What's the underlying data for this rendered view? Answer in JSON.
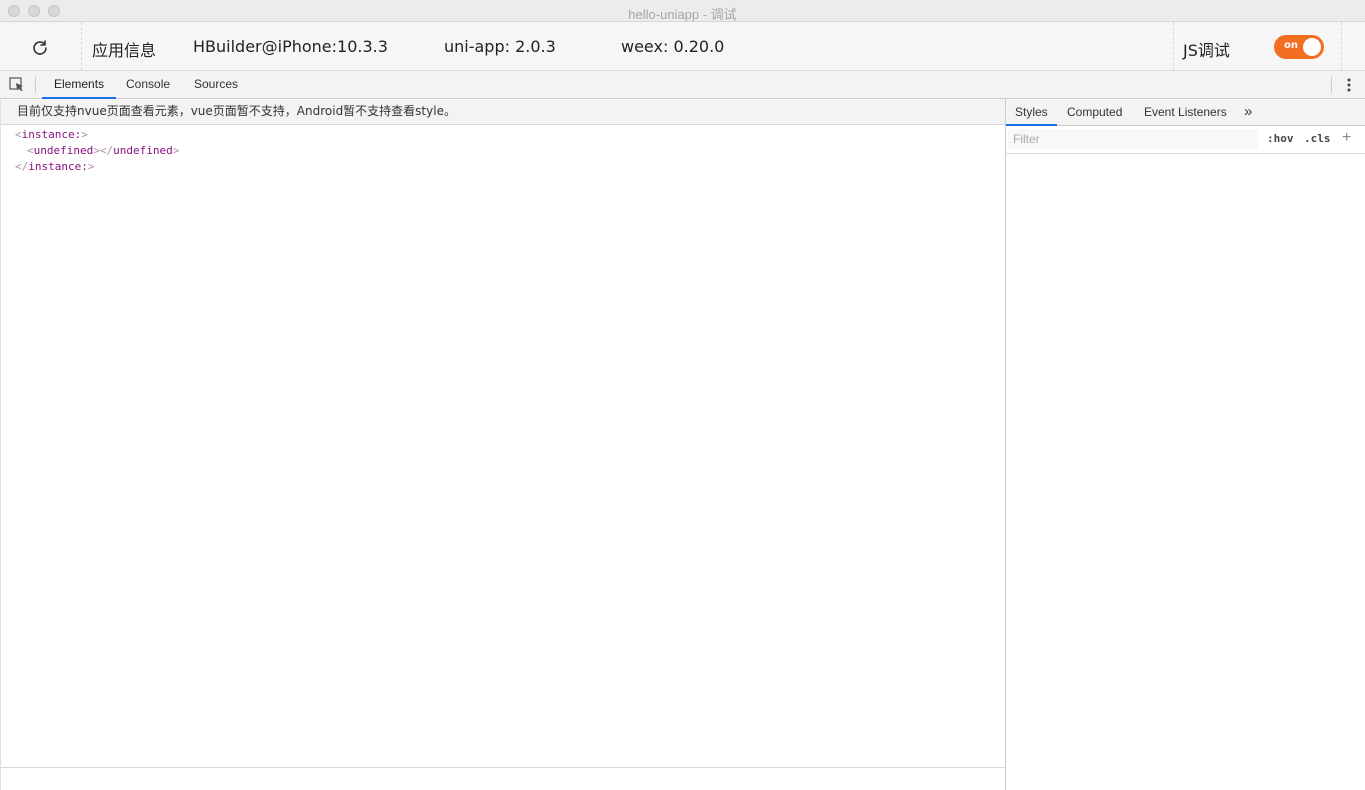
{
  "window": {
    "title": "hello-uniapp - 调试"
  },
  "infobar": {
    "app_info": "应用信息",
    "device": "HBuilder@iPhone:10.3.3",
    "uniapp_version": "uni-app: 2.0.3",
    "weex_version": "weex: 0.20.0",
    "js_debug_label": "JS调试",
    "toggle_label": "on"
  },
  "devtools": {
    "tabs": [
      {
        "label": "Elements"
      },
      {
        "label": "Console"
      },
      {
        "label": "Sources"
      }
    ]
  },
  "elements": {
    "notice": "目前仅支持nvue页面查看元素，vue页面暂不支持，Android暂不支持查看style。",
    "tree": {
      "root_tag": "instance:",
      "child_tag": "undefined"
    }
  },
  "sidebar": {
    "tabs": [
      {
        "label": "Styles"
      },
      {
        "label": "Computed"
      },
      {
        "label": "Event Listeners"
      }
    ],
    "more": "»",
    "filter_placeholder": "Filter",
    "hov": ":hov",
    "cls": ".cls",
    "plus": "+"
  },
  "colors": {
    "toggle_on": "#f26f21",
    "tab_active": "#1a73e8",
    "tag_name": "#881280"
  }
}
